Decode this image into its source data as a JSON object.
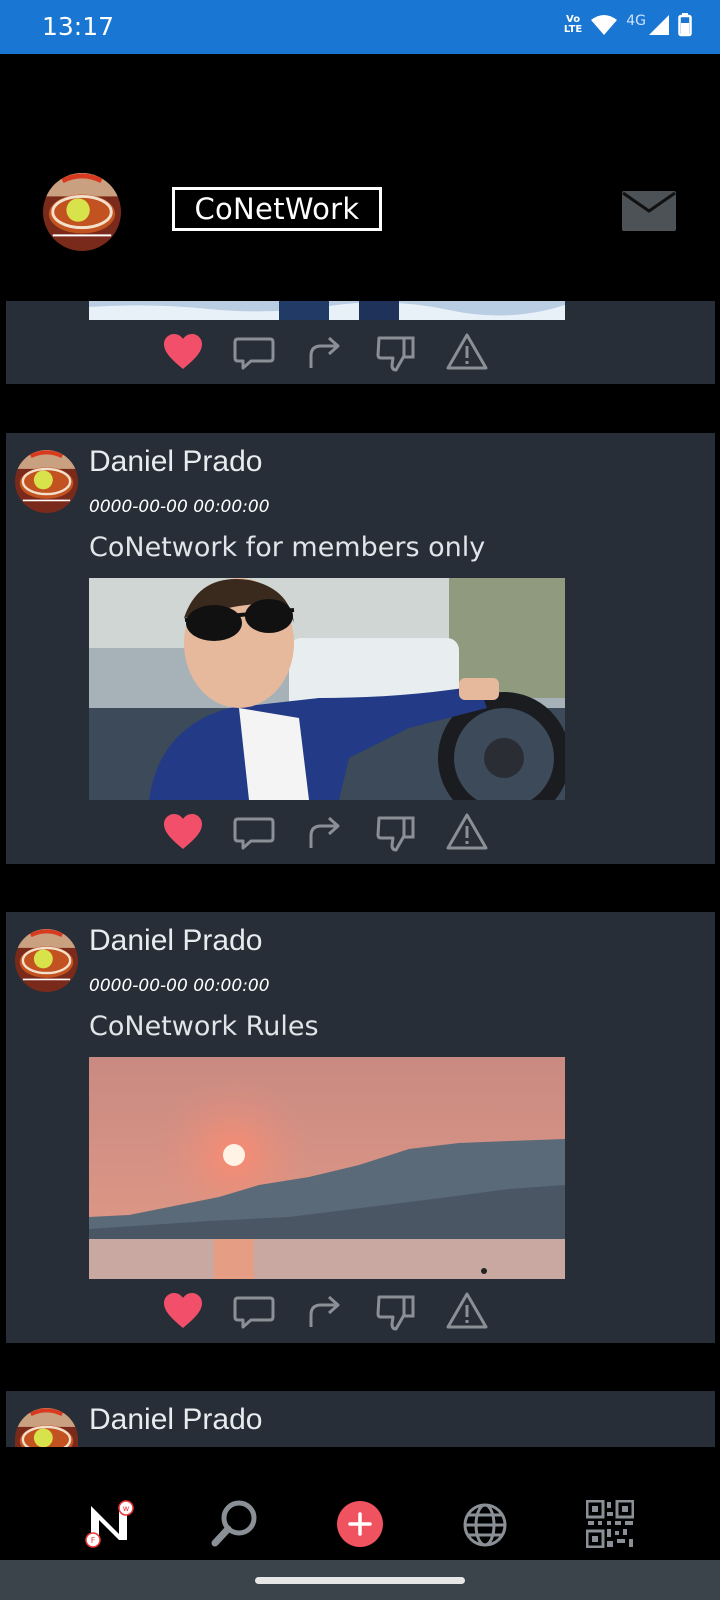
{
  "status_bar": {
    "time": "13:17",
    "network_label": "4G",
    "volte_top": "Vo",
    "volte_bottom": "LTE"
  },
  "header": {
    "logo_text": "CoNetWork"
  },
  "posts": [
    {
      "author": "Daniel Prado",
      "date": "0000-00-00 00:00:00",
      "text": "CoNetwork for members only"
    },
    {
      "author": "Daniel Prado",
      "date": "0000-00-00 00:00:00",
      "text": "CoNetwork Rules"
    },
    {
      "author": "Daniel Prado"
    }
  ],
  "post_actions": [
    "heart-icon",
    "comment-icon",
    "share-icon",
    "dislike-icon",
    "report-icon"
  ],
  "bottom_nav": [
    "home-logo-icon",
    "search-icon",
    "add-post-icon",
    "globe-icon",
    "qr-code-icon"
  ],
  "colors": {
    "status_bar": "#1976d2",
    "card_bg": "#272e37",
    "heart": "#f2506a",
    "add_button": "#f05360",
    "nav_icon": "#8a9096"
  }
}
